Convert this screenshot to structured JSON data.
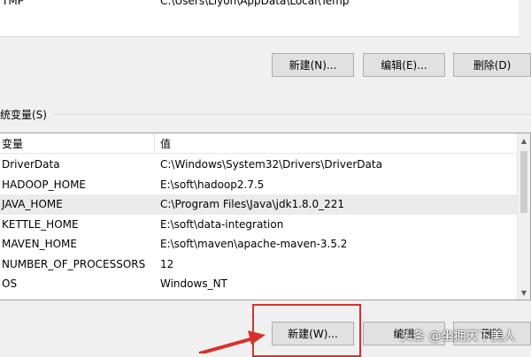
{
  "user_vars": {
    "partial_row": {
      "name": "TMP",
      "value": "C:\\Users\\Liyon\\AppData\\Local\\Temp"
    },
    "buttons": {
      "new": "新建(N)...",
      "edit": "编辑(E)...",
      "delete": "删除(D)"
    }
  },
  "system_vars": {
    "section_label": "统变量(S)",
    "columns": {
      "name": "变量",
      "value": "值"
    },
    "rows": [
      {
        "name": "DriverData",
        "value": "C:\\Windows\\System32\\Drivers\\DriverData"
      },
      {
        "name": "HADOOP_HOME",
        "value": "E:\\soft\\hadoop2.7.5"
      },
      {
        "name": "JAVA_HOME",
        "value": "C:\\Program Files\\Java\\jdk1.8.0_221"
      },
      {
        "name": "KETTLE_HOME",
        "value": "E:\\soft\\data-integration"
      },
      {
        "name": "MAVEN_HOME",
        "value": "E:\\soft\\maven\\apache-maven-3.5.2"
      },
      {
        "name": "NUMBER_OF_PROCESSORS",
        "value": "12"
      },
      {
        "name": "OS",
        "value": "Windows_NT"
      }
    ],
    "selected_row": "JAVA_HOME",
    "buttons": {
      "new": "新建(W)...",
      "edit": "编辑",
      "delete": "删除"
    }
  },
  "watermark": "头条 @坐拥天下美人",
  "colors": {
    "annotation_red": "#d9302a",
    "selection": "#ebebeb"
  }
}
